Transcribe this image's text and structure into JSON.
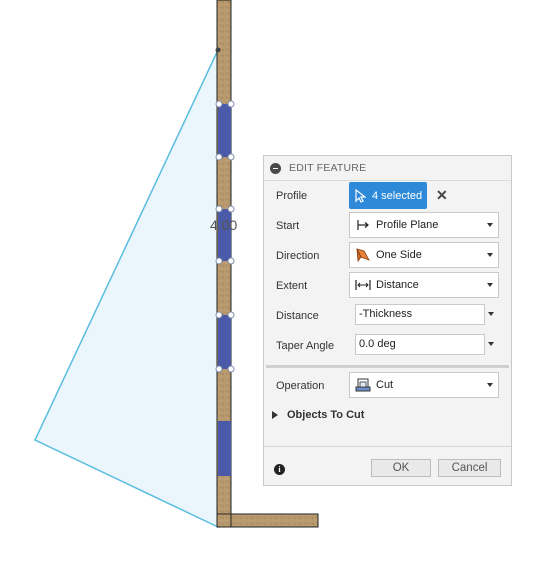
{
  "canvas": {
    "dimension_label": "4.00"
  },
  "panel": {
    "title": "EDIT FEATURE",
    "profile": {
      "label": "Profile",
      "selection": "4 selected",
      "clear_icon": "close-icon"
    },
    "start": {
      "label": "Start",
      "value": "Profile Plane",
      "icon": "profile-plane-icon"
    },
    "direction": {
      "label": "Direction",
      "value": "One Side",
      "icon": "one-side-icon"
    },
    "extent": {
      "label": "Extent",
      "value": "Distance",
      "icon": "distance-icon"
    },
    "distance": {
      "label": "Distance",
      "value": "-Thickness"
    },
    "taper": {
      "label": "Taper Angle",
      "value": "0.0 deg"
    },
    "operation": {
      "label": "Operation",
      "value": "Cut",
      "icon": "cut-icon"
    },
    "objects_to_cut": {
      "label": "Objects To Cut"
    },
    "footer": {
      "ok_label": "OK",
      "cancel_label": "Cancel"
    }
  },
  "colors": {
    "accent": "#2e8ad8",
    "wood": "#b89a6e",
    "profile_selected": "#4b5aa8",
    "plane_fill": "#eaf6fc",
    "plane_edge": "#5bbde0"
  }
}
